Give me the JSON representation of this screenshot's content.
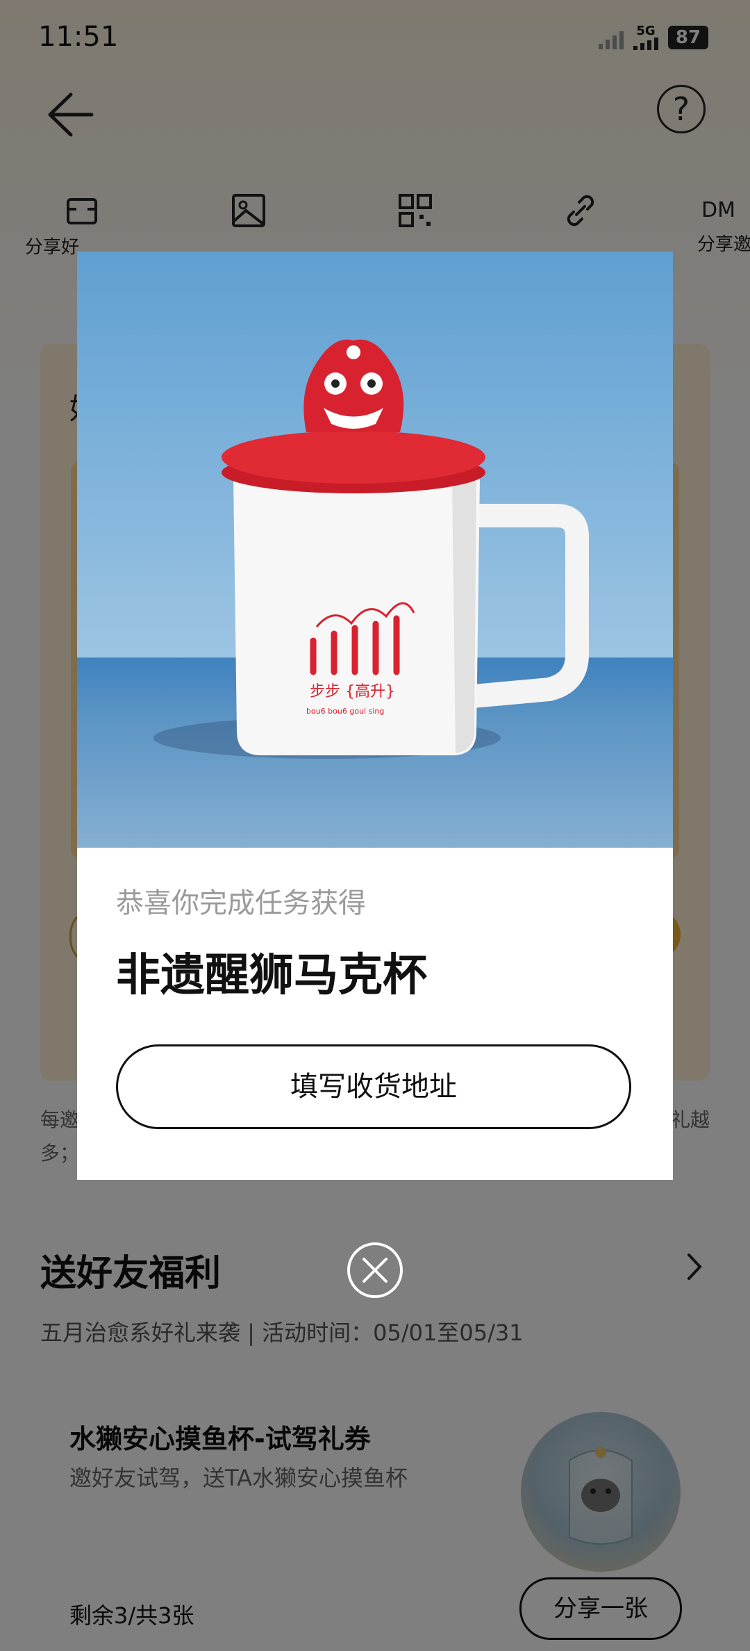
{
  "status_bar": {
    "time": "11:51",
    "network": "5G",
    "battery": "87"
  },
  "share_items": [
    {
      "label": "分享好",
      "icon": "share-card-icon"
    },
    {
      "label": "",
      "icon": "image-icon"
    },
    {
      "label": "",
      "icon": "qrcode-icon"
    },
    {
      "label": "",
      "icon": "link-icon"
    },
    {
      "label": "分享邀",
      "icon": "dm-icon",
      "icon_text": "DM"
    }
  ],
  "card": {
    "heading_partial": "好"
  },
  "note": {
    "left": "每邀",
    "right": "礼越",
    "second_line": "多；"
  },
  "friend_gift": {
    "title": "送好友福利",
    "subtitle": "五月治愈系好礼来袭 | 活动时间：05/01至05/31",
    "coupon": {
      "title": "水獭安心摸鱼杯-试驾礼券",
      "desc": "邀好友试驾，送TA水獭安心摸鱼杯",
      "remaining": "剩余3/共3张",
      "share_label": "分享一张"
    }
  },
  "modal": {
    "congrats": "恭喜你完成任务获得",
    "prize": "非遗醒狮马克杯",
    "button": "填写收货地址",
    "mug_text_main": "步步 {高升}",
    "mug_text_sub": "bou6 bou6   goul sing"
  },
  "colors": {
    "accent_red": "#d9222f",
    "overlay": "rgba(0,0,0,0.5)"
  }
}
